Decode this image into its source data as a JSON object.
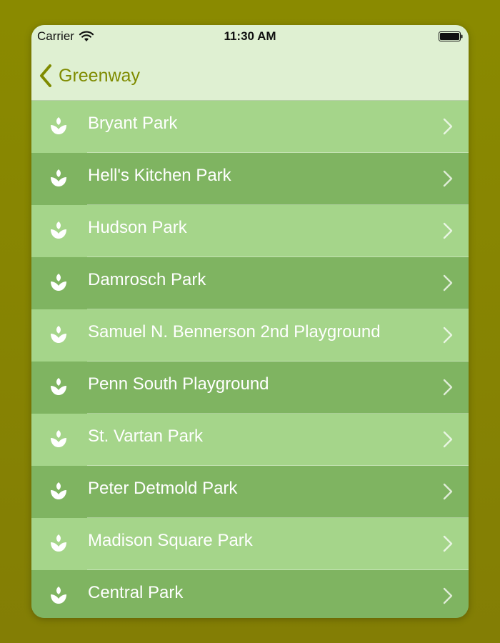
{
  "status_bar": {
    "carrier": "Carrier",
    "time": "11:30 AM",
    "wifi_icon": "wifi-icon",
    "battery_icon": "battery-icon"
  },
  "nav": {
    "back_label": "Greenway",
    "back_icon": "chevron-left-icon"
  },
  "parks": [
    {
      "label": "Bryant Park"
    },
    {
      "label": "Hell's Kitchen Park"
    },
    {
      "label": "Hudson Park"
    },
    {
      "label": "Damrosch Park"
    },
    {
      "label": "Samuel N. Bennerson 2nd Playground"
    },
    {
      "label": "Penn South Playground"
    },
    {
      "label": "St. Vartan Park"
    },
    {
      "label": "Peter Detmold Park"
    },
    {
      "label": "Madison Square Park"
    },
    {
      "label": "Central Park"
    }
  ],
  "row_icon": "plant-sprout-icon",
  "row_accessory_icon": "chevron-right-icon",
  "colors": {
    "background": "#8a8a00",
    "nav_background": "#dff0d2",
    "accent": "#7f8b00",
    "row_light": "#a5d58a",
    "row_dark": "#7fb461",
    "row_text": "#ffffff"
  }
}
